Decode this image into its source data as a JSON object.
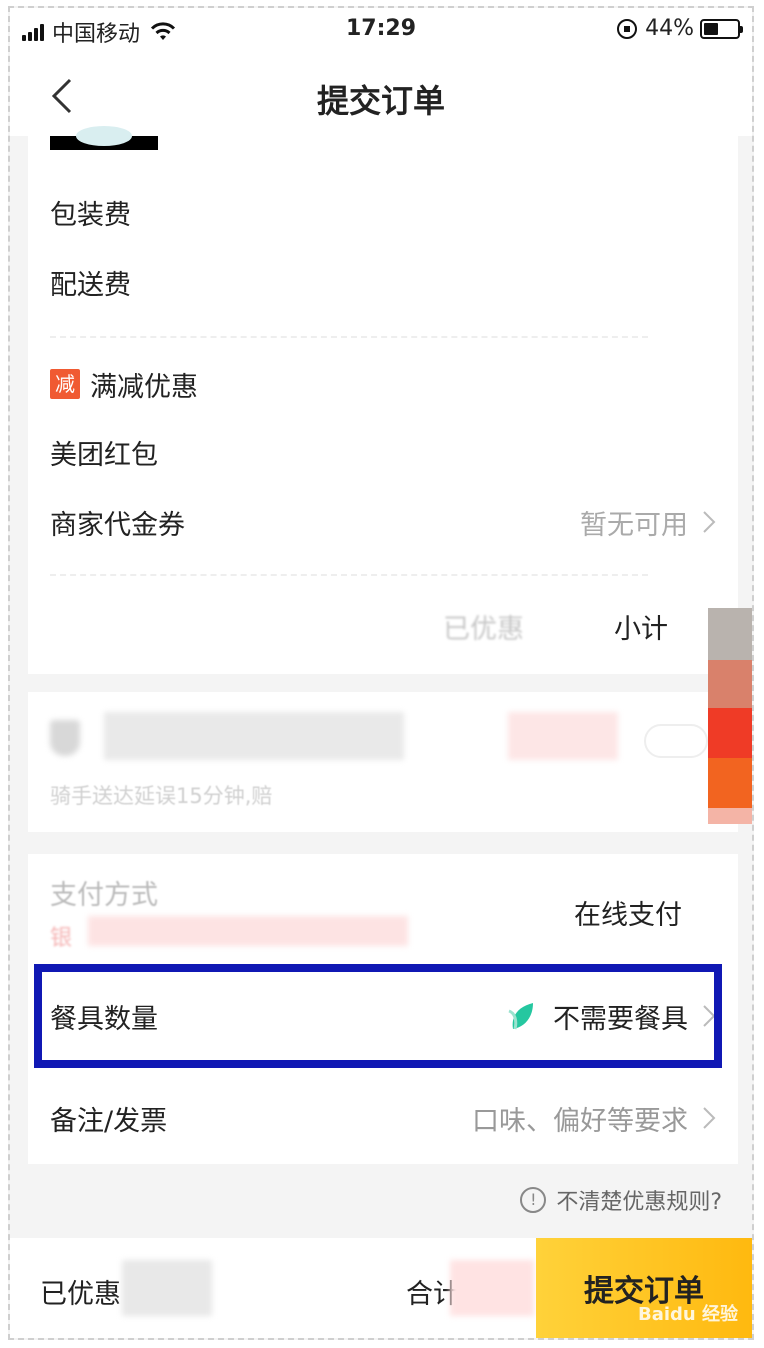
{
  "status_bar": {
    "carrier": "中国移动",
    "time": "17:29",
    "battery_percent": "44%",
    "battery_level": 0.44
  },
  "nav": {
    "title": "提交订单"
  },
  "fees": {
    "packing_label": "包装费",
    "delivery_label": "配送费",
    "manjian_tag": "减",
    "manjian_label": "满减优惠",
    "redpacket_label": "美团红包",
    "voucher_label": "商家代金券",
    "voucher_value": "暂无可用",
    "discounted_label": "已优惠",
    "subtotal_label": "小计"
  },
  "insurance": {
    "desc": "骑手送达延误15分钟,赔"
  },
  "payment": {
    "method_label": "支付方式",
    "bank_hint": "银",
    "method_value": "在线支付",
    "tableware_label": "餐具数量",
    "tableware_value": "不需要餐具",
    "note_label": "备注/发票",
    "note_value": "口味、偏好等要求"
  },
  "help": {
    "text": "不清楚优惠规则?"
  },
  "bottom": {
    "discounted_label": "已优惠",
    "total_label": "合计",
    "submit_label": "提交订单",
    "watermark": "Baidu 经验"
  },
  "colors": {
    "accent_yellow": "#ffc21f",
    "highlight_blue": "#1018b4",
    "tag_orange": "#f05a32",
    "leaf_teal": "#25c7a0"
  }
}
